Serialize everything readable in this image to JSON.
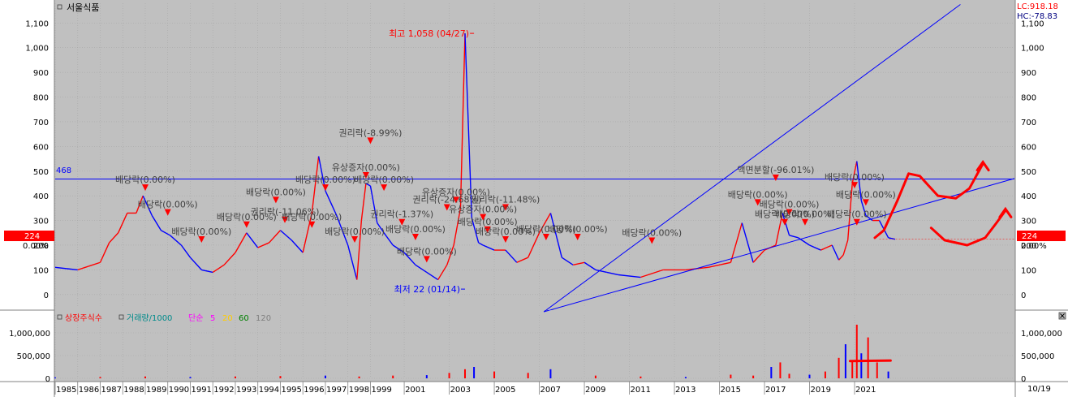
{
  "window": {
    "title": "서울식품",
    "lc_label": "LC:918.18",
    "hc_label": "HC:-78.83",
    "date_label": "10/19",
    "close_icon": "x-close-icon"
  },
  "colors": {
    "panel_bg": "#c0c0c0",
    "up": "#ff0000",
    "down": "#0000ff",
    "trend": "#0000ff",
    "current_price_bg": "#ff0000",
    "ma5": "#ff00ff",
    "ma20": "#ffcc00",
    "ma60": "#008000",
    "ma120": "#808080",
    "annotation": "#ff0000"
  },
  "chart_data": [
    {
      "type": "line",
      "panel": "price",
      "ylim": [
        -50,
        1180
      ],
      "yticks": [
        0,
        100,
        200,
        300,
        400,
        500,
        600,
        700,
        800,
        900,
        1000,
        1100
      ],
      "ytick_labels": [
        "0",
        "100",
        "200",
        "300",
        "400",
        "500",
        "600",
        "700",
        "800",
        "900",
        "1,000",
        "1,100"
      ],
      "right_extra_label": "0.00%",
      "current_price": 224,
      "current_price_label": "224",
      "horizontal_level": 468,
      "horizontal_level_label": "468",
      "x_years": [
        "1985",
        "1986",
        "1987",
        "1988",
        "1989",
        "1990",
        "1991",
        "1992",
        "1993",
        "1994",
        "1995",
        "1996",
        "1997",
        "1998",
        "1999",
        "2001",
        "2003",
        "2005",
        "2007",
        "2009",
        "2011",
        "2013",
        "2015",
        "2017",
        "2019",
        "2021"
      ],
      "x_year_positions": [
        1985,
        1986,
        1987,
        1988,
        1989,
        1990,
        1991,
        1992,
        1993,
        1994,
        1995,
        1996,
        1997,
        1998,
        1999,
        2000.5,
        2002.5,
        2004.5,
        2006.5,
        2008.5,
        2010.5,
        2012.5,
        2014.5,
        2016.5,
        2018.5,
        2020.5
      ],
      "xlim": [
        1985,
        2027.6
      ],
      "series": [
        {
          "x": [
            1985.0,
            1985.5,
            1986.0,
            1986.5,
            1987.0,
            1987.4,
            1987.8,
            1988.2,
            1988.6,
            1988.9,
            1989.3,
            1989.7,
            1990.1,
            1990.6,
            1991.0,
            1991.5,
            1992.0,
            1992.5,
            1993.0,
            1993.5,
            1994.0,
            1994.5,
            1995.0,
            1995.5,
            1996.0,
            1996.4,
            1996.7,
            1997.0,
            1997.5,
            1998.0,
            1998.4,
            1998.6,
            1998.8,
            1999.0,
            1999.3,
            1999.6,
            2000.0,
            2000.5,
            2001.0,
            2001.5,
            2002.0,
            2002.4,
            2002.7,
            2003.0,
            2003.2,
            2003.5,
            2003.8,
            2004.0,
            2004.5,
            2005.0,
            2005.5,
            2006.0,
            2006.5,
            2007.0,
            2007.5,
            2008.0,
            2008.5,
            2009.0,
            2009.5,
            2010.0,
            2011.0,
            2012.0,
            2013.0,
            2014.0,
            2015.0,
            2015.5,
            2016.0,
            2016.5,
            2017.0,
            2017.3,
            2017.6,
            2018.0,
            2018.5,
            2019.0,
            2019.5,
            2019.8,
            2020.0,
            2020.2,
            2020.4,
            2020.6,
            2020.8,
            2021.0,
            2021.3,
            2021.6,
            2022.0,
            2022.3
          ],
          "values": [
            110,
            105,
            100,
            115,
            130,
            210,
            250,
            330,
            330,
            400,
            320,
            260,
            240,
            200,
            150,
            100,
            90,
            120,
            170,
            250,
            190,
            210,
            260,
            220,
            170,
            330,
            560,
            420,
            320,
            200,
            60,
            300,
            450,
            440,
            290,
            250,
            200,
            170,
            120,
            90,
            60,
            120,
            200,
            350,
            1058,
            310,
            210,
            200,
            180,
            180,
            130,
            150,
            250,
            330,
            150,
            120,
            130,
            100,
            90,
            80,
            70,
            100,
            100,
            110,
            130,
            290,
            130,
            180,
            200,
            330,
            240,
            230,
            200,
            180,
            200,
            140,
            160,
            220,
            450,
            540,
            380,
            320,
            300,
            300,
            230,
            224
          ]
        }
      ],
      "annotations": [
        {
          "text": "최고 1,058 (04/27)",
          "x": 2003.6,
          "y": 1058,
          "color": "#ff0000",
          "side": "left"
        },
        {
          "text": "최저 22 (01/14)",
          "x": 2003.2,
          "y": 22,
          "color": "#0000ff",
          "side": "left"
        },
        {
          "text": "배당락(0.00%)",
          "x": 1989.0,
          "y": 400
        },
        {
          "text": "배당락(0.00%)",
          "x": 1990.0,
          "y": 300
        },
        {
          "text": "배당락(0.00%)",
          "x": 1991.5,
          "y": 190
        },
        {
          "text": "배당락(0.00%)",
          "x": 1993.5,
          "y": 250
        },
        {
          "text": "배당락(0.00%)",
          "x": 1994.8,
          "y": 350
        },
        {
          "text": "권리락(-11.06%)",
          "x": 1995.2,
          "y": 270
        },
        {
          "text": "배당락(0.00%)",
          "x": 1996.4,
          "y": 250
        },
        {
          "text": "배당락(0.00%)",
          "x": 1998.3,
          "y": 190
        },
        {
          "text": "권리락(-8.99%)",
          "x": 1999.0,
          "y": 590
        },
        {
          "text": "유상증자(0.00%)",
          "x": 1998.8,
          "y": 450
        },
        {
          "text": "배당락(0.00%)",
          "x": 1999.6,
          "y": 400
        },
        {
          "text": "배당락(0.00%)",
          "x": 1997.0,
          "y": 400
        },
        {
          "text": "권리락(-1.37%)",
          "x": 2000.4,
          "y": 260
        },
        {
          "text": "배당락(0.00%)",
          "x": 2001.0,
          "y": 200
        },
        {
          "text": "배당락(0.00%)",
          "x": 2001.5,
          "y": 110
        },
        {
          "text": "유상증자(0.00%)",
          "x": 2002.8,
          "y": 350
        },
        {
          "text": "권리락(-24.68%)",
          "x": 2002.4,
          "y": 320
        },
        {
          "text": "권리락(-11.48%)",
          "x": 2005.0,
          "y": 320
        },
        {
          "text": "유상증자(0.00%)",
          "x": 2004.0,
          "y": 280
        },
        {
          "text": "배당락(0.00%)",
          "x": 2004.2,
          "y": 230
        },
        {
          "text": "배당락(0.00%)",
          "x": 2005.0,
          "y": 190
        },
        {
          "text": "배당락(0.00%)",
          "x": 2006.8,
          "y": 200
        },
        {
          "text": "배당락(0.00%)",
          "x": 2008.2,
          "y": 200
        },
        {
          "text": "배당락(0.00%)",
          "x": 2011.5,
          "y": 185
        },
        {
          "text": "액면분할(-96.01%)",
          "x": 2017.0,
          "y": 440
        },
        {
          "text": "배당락(0.00%)",
          "x": 2016.2,
          "y": 340
        },
        {
          "text": "배당락(0.00%)",
          "x": 2017.6,
          "y": 300
        },
        {
          "text": "배당락(0.00%)",
          "x": 2017.4,
          "y": 260
        },
        {
          "text": "배당락(0.00%)",
          "x": 2018.3,
          "y": 260
        },
        {
          "text": "배당락(0.00%)",
          "x": 2020.5,
          "y": 410
        },
        {
          "text": "배당락(0.00%)",
          "x": 2021.0,
          "y": 340
        },
        {
          "text": "배당락(0.00%)",
          "x": 2020.6,
          "y": 260
        }
      ],
      "trendlines": [
        {
          "x": [
            2006.7,
            2025.2
          ],
          "y": [
            -70,
            1175
          ]
        },
        {
          "x": [
            2006.7,
            2027.6
          ],
          "y": [
            -70,
            470
          ]
        }
      ],
      "handdrawn": [
        {
          "x": [
            2021.4,
            2021.8,
            2022.4,
            2022.9,
            2023.4,
            2024.2,
            2025.0,
            2025.6,
            2026.2
          ],
          "y": [
            230,
            260,
            380,
            490,
            480,
            400,
            390,
            430,
            530
          ]
        },
        {
          "x": [
            2023.9,
            2024.5,
            2025.5,
            2026.3,
            2026.8,
            2027.2
          ],
          "y": [
            270,
            220,
            200,
            230,
            290,
            340
          ]
        }
      ],
      "handdrawn_arrowheads": [
        {
          "x": 2026.2,
          "y": 530,
          "dir": "up"
        },
        {
          "x": 2027.2,
          "y": 340,
          "dir": "up"
        }
      ]
    },
    {
      "type": "bar",
      "panel": "volume",
      "legend": [
        {
          "text": "상장주식수",
          "color": "#ff0000"
        },
        {
          "text": "거래량/1000",
          "color": "#008b8b"
        },
        {
          "text": "단순",
          "color": "#ff00ff"
        },
        {
          "text": "5",
          "color": "#ff00ff"
        },
        {
          "text": "20",
          "color": "#ffcc00"
        },
        {
          "text": "60",
          "color": "#008000"
        },
        {
          "text": "120",
          "color": "#808080"
        }
      ],
      "ylim": [
        0,
        1250000
      ],
      "yticks": [
        0,
        500000,
        1000000
      ],
      "ytick_labels": [
        "0",
        "500,000",
        "1,000,000"
      ],
      "x": [
        1985,
        1987,
        1989,
        1991,
        1993,
        1995,
        1997,
        1998.5,
        2000,
        2001.5,
        2002.5,
        2003.2,
        2003.6,
        2004.5,
        2006,
        2007,
        2009,
        2011,
        2013,
        2015,
        2016,
        2016.8,
        2017.2,
        2017.6,
        2018.5,
        2019.2,
        2019.8,
        2020.1,
        2020.4,
        2020.6,
        2020.8,
        2021.1,
        2021.5,
        2022
      ],
      "values": [
        20000,
        30000,
        40000,
        30000,
        40000,
        50000,
        60000,
        40000,
        60000,
        70000,
        120000,
        200000,
        250000,
        150000,
        120000,
        200000,
        60000,
        40000,
        30000,
        80000,
        60000,
        250000,
        350000,
        100000,
        80000,
        150000,
        450000,
        750000,
        380000,
        1180000,
        550000,
        900000,
        350000,
        150000
      ],
      "handdrawn": [
        {
          "x": [
            2020.3,
            2022.1
          ],
          "y": [
            380000,
            390000
          ]
        }
      ]
    }
  ]
}
